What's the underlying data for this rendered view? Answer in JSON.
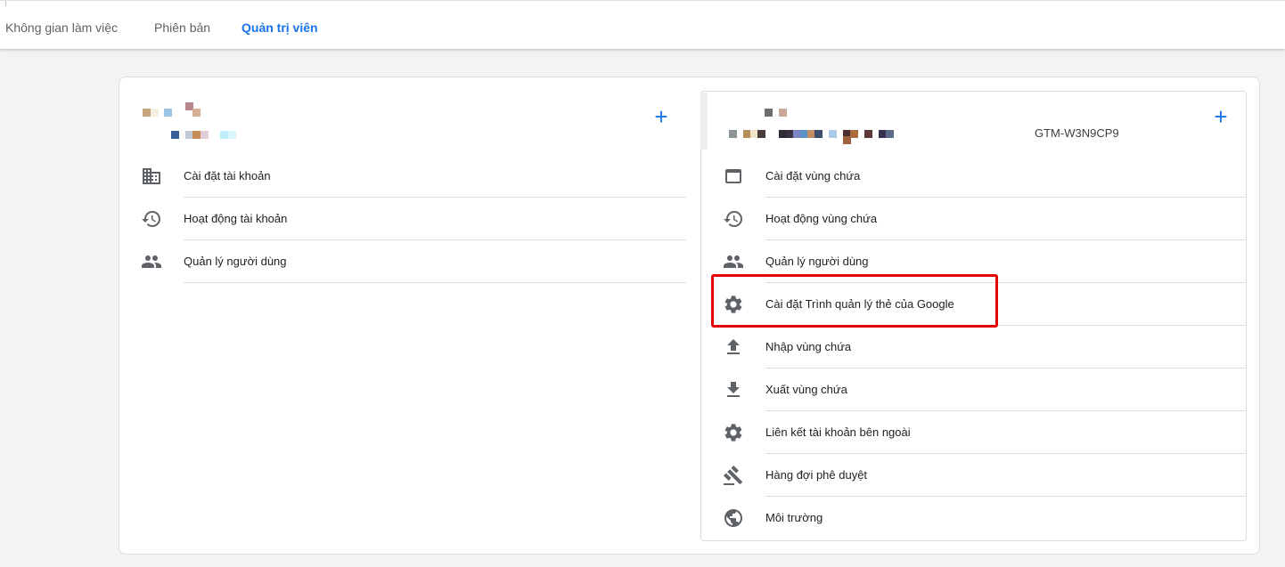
{
  "nav": {
    "tabs": [
      {
        "label": "Không gian làm việc",
        "active": false
      },
      {
        "label": "Phiên bản",
        "active": false
      },
      {
        "label": "Quản trị viên",
        "active": true
      }
    ]
  },
  "account": {
    "add_icon": "+",
    "menu": [
      {
        "label": "Cài đặt tài khoản",
        "icon": "domain-icon"
      },
      {
        "label": "Hoạt động tài khoản",
        "icon": "history-icon"
      },
      {
        "label": "Quản lý người dùng",
        "icon": "people-icon"
      }
    ]
  },
  "container": {
    "id": "GTM-W3N9CP9",
    "add_icon": "+",
    "menu": [
      {
        "label": "Cài đặt vùng chứa",
        "icon": "web-asset-icon"
      },
      {
        "label": "Hoạt động vùng chứa",
        "icon": "history-icon"
      },
      {
        "label": "Quản lý người dùng",
        "icon": "people-icon"
      },
      {
        "label": "Cài đặt Trình quản lý thẻ của Google",
        "icon": "gear-icon"
      },
      {
        "label": "Nhập vùng chứa",
        "icon": "upload-icon"
      },
      {
        "label": "Xuất vùng chứa",
        "icon": "download-icon"
      },
      {
        "label": "Liên kết tài khoản bên ngoài",
        "icon": "gear-icon"
      },
      {
        "label": "Hàng đợi phê duyệt",
        "icon": "gavel-icon"
      },
      {
        "label": "Môi trường",
        "icon": "globe-icon"
      }
    ]
  },
  "colors": {
    "accent": "#1a73e8",
    "highlight_box": "#e60000",
    "icon": "#5f6368",
    "divider": "#dadce0"
  }
}
